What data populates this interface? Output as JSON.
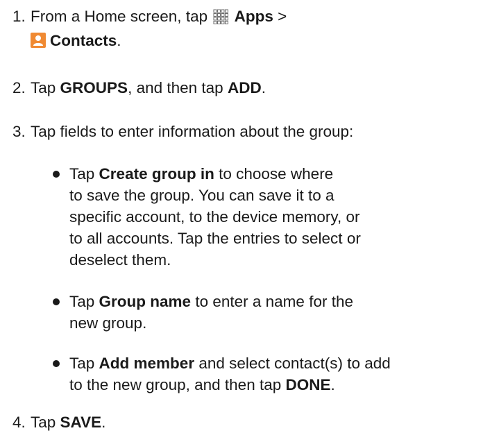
{
  "steps": [
    {
      "num": "1.",
      "t1": "From a Home screen, tap",
      "apps_label": "Apps",
      "t2": ">",
      "contacts_label": "Contacts",
      "t3": "."
    },
    {
      "num": "2.",
      "t1": "Tap",
      "b1": "GROUPS",
      "t2": ", and then tap",
      "b2": "ADD",
      "t3": "."
    },
    {
      "num": "3.",
      "t1": "Tap fields to enter information about the group:"
    },
    {
      "num": "4.",
      "t1": "Tap",
      "b1": "SAVE",
      "t2": "."
    }
  ],
  "bullets": [
    {
      "t1": "Tap",
      "b1": "Create group in",
      "l1": "to choose where",
      "l2": "to save the group. You can save it to a",
      "l3": "specific account, to the device memory, or",
      "l4": "to all accounts. Tap the entries to select or",
      "l5": "deselect them."
    },
    {
      "t1": "Tap",
      "b1": "Group name",
      "l1": "to enter a name for the",
      "l2": "new group."
    },
    {
      "t1": "Tap",
      "b1": "Add member",
      "l1": "and select contact(s) to add",
      "l2": "to the new group, and then tap",
      "b2": "DONE",
      "t2": "."
    }
  ],
  "icons": {
    "apps": "apps-grid-icon",
    "contacts": "contacts-person-icon",
    "contacts_color": "#f08a33"
  }
}
